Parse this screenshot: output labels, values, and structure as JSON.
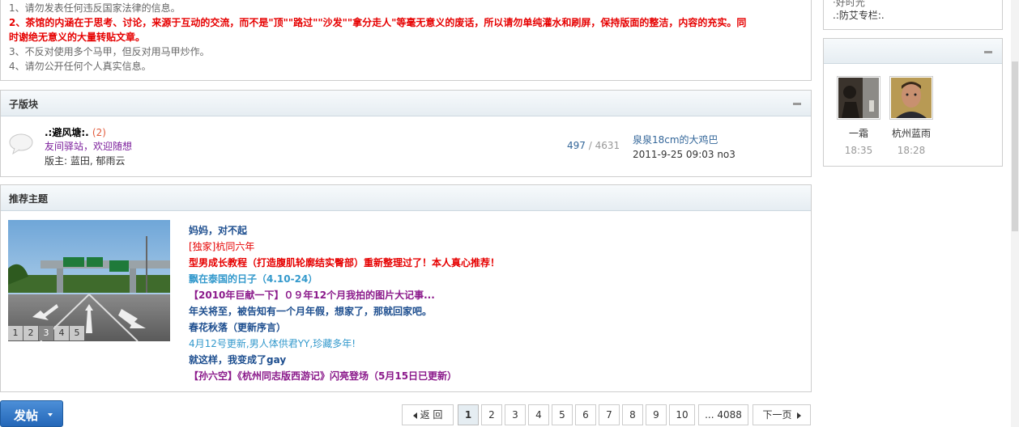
{
  "rules": {
    "r1": "1、请勿发表任何违反国家法律的信息。",
    "r2a": "2、茶馆的内涵在于思考、讨论，来源于互动的交流，而不是\"顶\"\"路过\"\"沙发\"\"拿分走人\"等毫无意义的废话，所以请勿单纯灌水和刷屏，保持版面的整洁，内容的充实。同",
    "r2b": "时谢绝无意义的大量转贴文章。",
    "r3": "3、不反对使用多个马甲，但反对用马甲炒作。",
    "r4": "4、请勿公开任何个人真实信息。"
  },
  "subforum": {
    "title": "子版块",
    "name": ".:避风塘:.",
    "new_count": "(2)",
    "description": "友间驿站，欢迎随想",
    "moderators_label": "版主: ",
    "moderators": "蓝田, 郁雨云",
    "threads": "497",
    "sep": " / ",
    "posts": "4631",
    "last_title": "泉泉18cm的大鸡巴",
    "last_meta": "2011-9-25 09:03 no3"
  },
  "recommend": {
    "title": "推荐主题",
    "slide_nums": [
      "1",
      "2",
      "3",
      "4",
      "5"
    ],
    "active_slide": 3,
    "threads": [
      {
        "title": "妈妈，对不起",
        "color": "#1d4e8f",
        "bold": true
      },
      {
        "title": "[独家]杭同六年",
        "color": "#e60000",
        "bold": false
      },
      {
        "title": "型男成长教程（打造腹肌轮廓结实臀部）重新整理过了！本人真心推荐！",
        "color": "#e60000",
        "bold": true
      },
      {
        "title": "飘在泰国的日子（4.10-24）",
        "color": "#3399cc",
        "bold": true
      },
      {
        "title": "【2010年巨献一下】０９年12个月我拍的图片大记事...",
        "color": "#8b1a8b",
        "bold": true
      },
      {
        "title": "年关将至，被告知有一个月年假，想家了，那就回家吧。",
        "color": "#1d4e8f",
        "bold": true
      },
      {
        "title": "春花秋落（更新序言）",
        "color": "#1d4e8f",
        "bold": true
      },
      {
        "title": "4月12号更新,男人体供君YY,珍藏多年!",
        "color": "#3399cc",
        "bold": false
      },
      {
        "title": "就这样，我变成了gay",
        "color": "#1d4e8f",
        "bold": true
      },
      {
        "title": "【孙六空】《杭州同志版西游记》闪亮登场（5月15日已更新）",
        "color": "#8b1a8b",
        "bold": true
      }
    ]
  },
  "post_button": "发帖",
  "pager": {
    "prev": "返 回",
    "pages": [
      "1",
      "2",
      "3",
      "4",
      "5",
      "6",
      "7",
      "8",
      "9",
      "10"
    ],
    "current": "1",
    "last": "... 4088",
    "next": "下一页"
  },
  "side": {
    "line1": "·好时光",
    "line2": ".:防艾专栏:.",
    "users": [
      {
        "name": "一霜",
        "time": "18:35"
      },
      {
        "name": "杭州蓝雨",
        "time": "18:28"
      }
    ]
  }
}
